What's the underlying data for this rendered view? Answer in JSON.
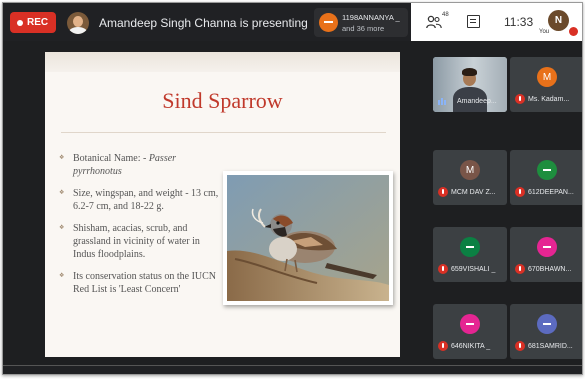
{
  "topbar": {
    "rec_label": "REC",
    "presenting_text": "Amandeep Singh Channa is presenting",
    "participants_chip": {
      "line1": "1198ANNANYA _",
      "line2": "and 36 more"
    },
    "people_count": "48",
    "time": "11:33",
    "you_initial": "N",
    "you_label": "You"
  },
  "slide": {
    "title": "Sind Sparrow",
    "bullets": [
      {
        "prefix": "Botanical Name: - ",
        "italic": "Passer pyrrhonotus"
      },
      {
        "text": "Size, wingspan, and weight - 13 cm, 6.2-7 cm, and 18-22 g."
      },
      {
        "text": "Shisham, acacias, scrub, and grassland in vicinity of water in Indus floodplains."
      },
      {
        "text": "Its conservation status on the IUCN Red List is 'Least Concern'"
      }
    ]
  },
  "participants": [
    {
      "name": "Amandeep...",
      "avatar": "video"
    },
    {
      "name": "Ms. Kadam...",
      "initial": "M",
      "color": "#e8711a"
    },
    {
      "name": "MCM DAV Z...",
      "initial": "M",
      "color": "#795548"
    },
    {
      "name": "612DEEPAN...",
      "initial": "",
      "color": "#1e8e3e"
    },
    {
      "name": "659VISHALI _",
      "initial": "",
      "color": "#0b8043"
    },
    {
      "name": "670BHAWN...",
      "initial": "",
      "color": "#e52592"
    },
    {
      "name": "646NIKITA _",
      "initial": "",
      "color": "#e52592"
    },
    {
      "name": "681SAMRID...",
      "initial": "",
      "color": "#5c6bc0"
    }
  ],
  "colors": {
    "rec": "#d93025",
    "title": "#c0392b",
    "background": "#1e1f21"
  }
}
